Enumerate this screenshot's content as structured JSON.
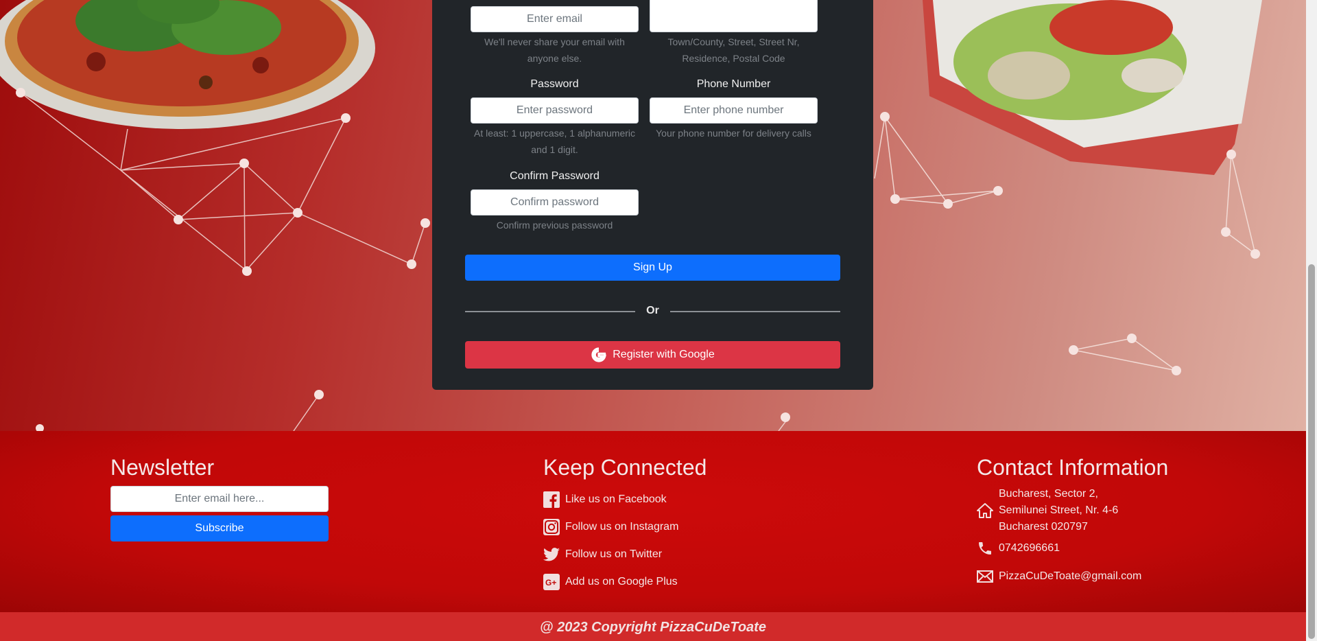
{
  "form": {
    "email_placeholder": "Enter email",
    "email_hint": "We'll never share your email with anyone else.",
    "address_hint": "Town/County, Street, Street Nr, Residence, Postal Code",
    "password_label": "Password",
    "password_placeholder": "Enter password",
    "password_hint": "At least: 1 uppercase, 1 alphanumeric and 1 digit.",
    "phone_label": "Phone Number",
    "phone_placeholder": "Enter phone number",
    "phone_hint": "Your phone number for delivery calls",
    "confirm_label": "Confirm Password",
    "confirm_placeholder": "Confirm password",
    "confirm_hint": "Confirm previous password",
    "signup_label": "Sign Up",
    "or_label": "Or",
    "google_label": "Register with Google"
  },
  "footer": {
    "newsletter": {
      "title": "Newsletter",
      "input_placeholder": "Enter email here...",
      "button_label": "Subscribe"
    },
    "social": {
      "title": "Keep Connected",
      "items": [
        {
          "label": "Like us on Facebook",
          "icon": "facebook-icon"
        },
        {
          "label": "Follow us on Instagram",
          "icon": "instagram-icon"
        },
        {
          "label": "Follow us on Twitter",
          "icon": "twitter-icon"
        },
        {
          "label": "Add us on Google Plus",
          "icon": "google-plus-icon"
        }
      ]
    },
    "contact": {
      "title": "Contact Information",
      "address_lines": [
        "Bucharest, Sector 2,",
        "Semilunei Street, Nr. 4-6",
        "Bucharest 020797"
      ],
      "phone": "0742696661",
      "email": "PizzaCuDeToate@gmail.com"
    },
    "copyright": "@ 2023 Copyright PizzaCuDeToate"
  },
  "colors": {
    "primary": "#0d6efd",
    "danger": "#dc3545",
    "card_bg": "#212529",
    "footer_bg": "#c10808"
  }
}
